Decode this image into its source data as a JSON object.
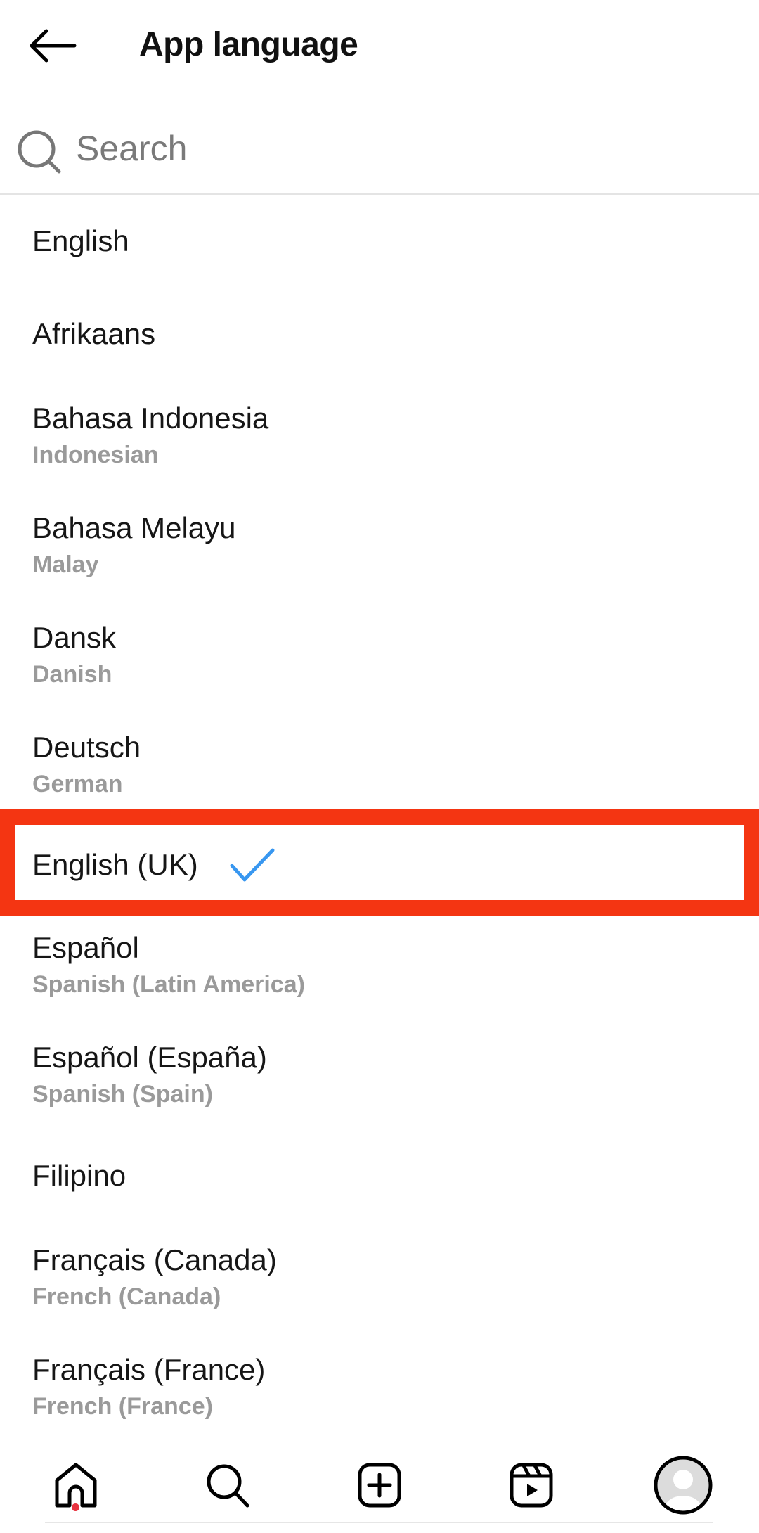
{
  "header": {
    "title": "App language",
    "back_icon": "arrow-left-icon"
  },
  "search": {
    "placeholder": "Search",
    "value": "",
    "icon": "search-icon"
  },
  "languages": [
    {
      "name": "English",
      "sub": ""
    },
    {
      "name": "Afrikaans",
      "sub": ""
    },
    {
      "name": "Bahasa Indonesia",
      "sub": "Indonesian"
    },
    {
      "name": "Bahasa Melayu",
      "sub": "Malay"
    },
    {
      "name": "Dansk",
      "sub": "Danish"
    },
    {
      "name": "Deutsch",
      "sub": "German"
    },
    {
      "name": "English (UK)",
      "sub": "",
      "selected": true
    },
    {
      "name": "Español",
      "sub": "Spanish (Latin America)"
    },
    {
      "name": "Español (España)",
      "sub": "Spanish (Spain)"
    },
    {
      "name": "Filipino",
      "sub": ""
    },
    {
      "name": "Français (Canada)",
      "sub": "French (Canada)"
    },
    {
      "name": "Français (France)",
      "sub": "French (France)"
    }
  ],
  "colors": {
    "check": "#3897f0",
    "highlight": "#f43512",
    "notification_dot": "#e8323f"
  },
  "nav": [
    "home-icon",
    "search-icon",
    "create-icon",
    "reels-icon",
    "profile-avatar"
  ]
}
